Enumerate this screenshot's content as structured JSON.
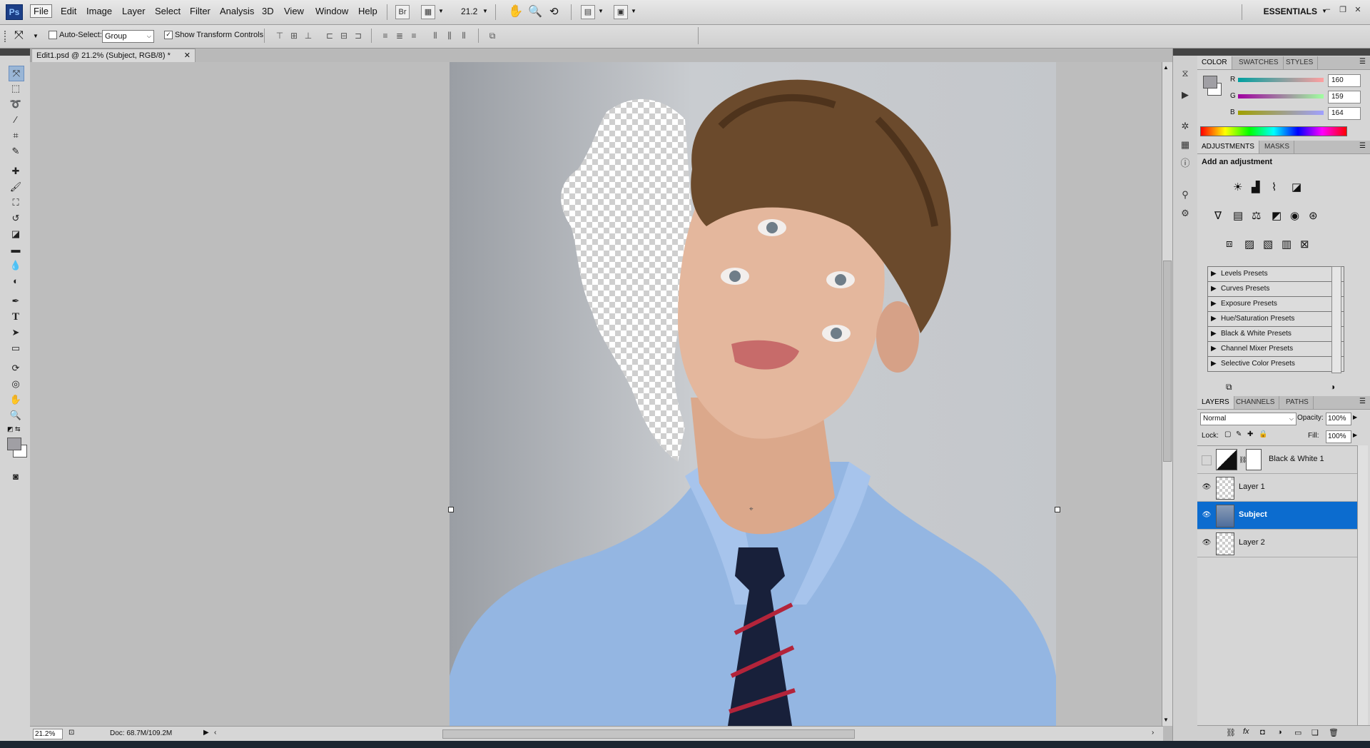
{
  "menubar": {
    "logo": "Ps",
    "items": [
      "File",
      "Edit",
      "Image",
      "Layer",
      "Select",
      "Filter",
      "Analysis",
      "3D",
      "View",
      "Window",
      "Help"
    ],
    "bridge": "Br",
    "zoom_value": "21.2",
    "workspace": "ESSENTIALS"
  },
  "options": {
    "auto_select_label": "Auto-Select:",
    "auto_select_value": "Group",
    "show_transform_label": "Show Transform Controls"
  },
  "document": {
    "tab_title": "Edit1.psd @ 21.2% (Subject, RGB/8) *"
  },
  "status": {
    "zoom": "21.2%",
    "doc_info": "Doc: 68.7M/109.2M"
  },
  "color_panel": {
    "tabs": [
      "COLOR",
      "SWATCHES",
      "STYLES"
    ],
    "r_label": "R",
    "g_label": "G",
    "b_label": "B",
    "r": "160",
    "g": "159",
    "b": "164"
  },
  "adjustments_panel": {
    "tabs": [
      "ADJUSTMENTS",
      "MASKS"
    ],
    "heading": "Add an adjustment",
    "presets": [
      "Levels Presets",
      "Curves Presets",
      "Exposure Presets",
      "Hue/Saturation Presets",
      "Black & White Presets",
      "Channel Mixer Presets",
      "Selective Color Presets"
    ]
  },
  "layers_panel": {
    "tabs": [
      "LAYERS",
      "CHANNELS",
      "PATHS"
    ],
    "blend_mode": "Normal",
    "opacity_label": "Opacity:",
    "opacity": "100%",
    "lock_label": "Lock:",
    "fill_label": "Fill:",
    "fill": "100%",
    "layers": [
      {
        "name": "Black & White 1",
        "visible": false,
        "selected": false
      },
      {
        "name": "Layer 1",
        "visible": true,
        "selected": false
      },
      {
        "name": "Subject",
        "visible": true,
        "selected": true
      },
      {
        "name": "Layer 2",
        "visible": true,
        "selected": false
      }
    ]
  }
}
